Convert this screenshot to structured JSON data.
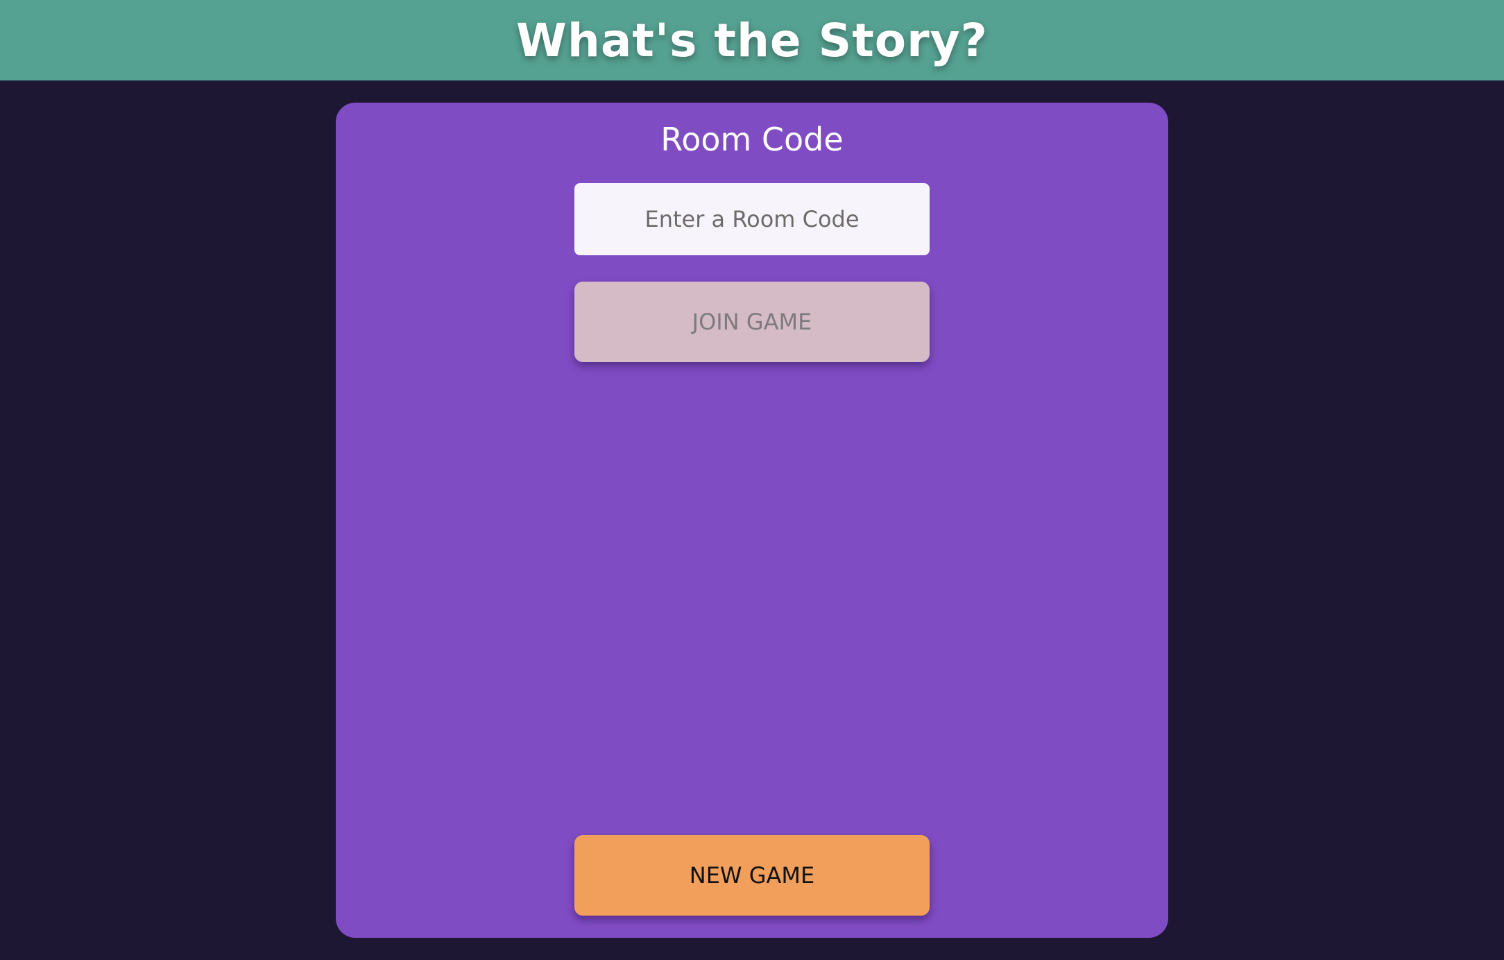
{
  "header": {
    "title": "What's the Story?"
  },
  "room": {
    "label": "Room Code",
    "input_value": "",
    "input_placeholder": "Enter a Room Code"
  },
  "buttons": {
    "join_label": "JOIN GAME",
    "new_label": "NEW GAME"
  },
  "colors": {
    "header_bg": "#56a292",
    "page_bg": "#1d1734",
    "card_bg": "#804cc4",
    "join_button_bg": "#d4bbc6",
    "new_button_bg": "#f29f5c"
  }
}
